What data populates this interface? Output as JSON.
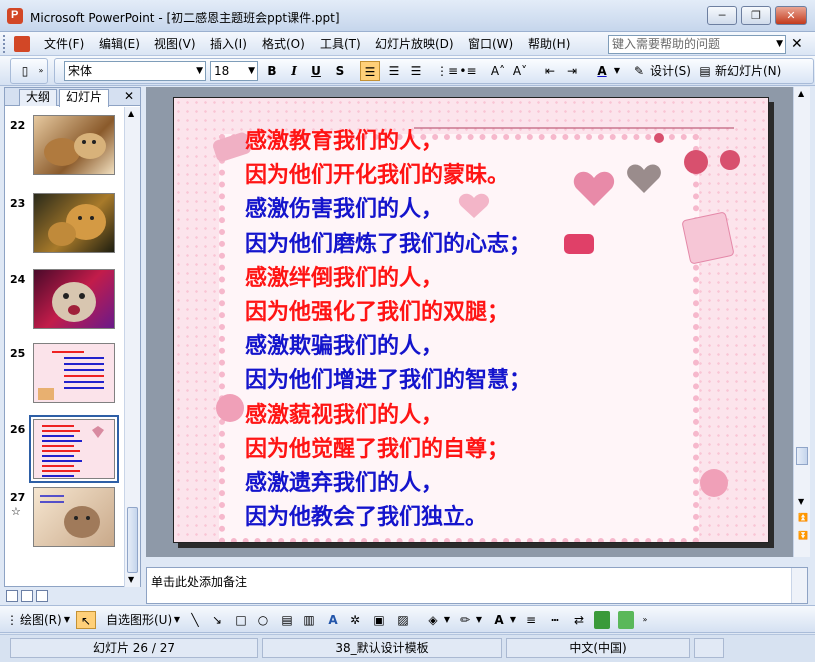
{
  "window": {
    "title": "Microsoft PowerPoint - [初二感恩主题班会ppt课件.ppt]",
    "minimize": "─",
    "restore": "❐",
    "close": "✕"
  },
  "menu": {
    "items": [
      "文件(F)",
      "编辑(E)",
      "视图(V)",
      "插入(I)",
      "格式(O)",
      "工具(T)",
      "幻灯片放映(D)",
      "窗口(W)",
      "帮助(H)"
    ],
    "help_placeholder": "键入需要帮助的问题",
    "close": "✕"
  },
  "toolbar": {
    "font_name": "宋体",
    "font_size": "18",
    "bold": "B",
    "italic": "I",
    "underline": "U",
    "shadow": "S",
    "font_color": "A",
    "design_label": "设计(S)",
    "new_slide_label": "新幻灯片(N)"
  },
  "left_panel": {
    "tab_outline": "大纲",
    "tab_slides": "幻灯片",
    "close": "✕",
    "slides": [
      {
        "num": "22",
        "icon": "cat-photo"
      },
      {
        "num": "23",
        "icon": "cat-photo"
      },
      {
        "num": "24",
        "icon": "cat-photo"
      },
      {
        "num": "25",
        "icon": "text-slide"
      },
      {
        "num": "26",
        "icon": "text-slide",
        "selected": true
      },
      {
        "num": "27",
        "icon": "cat-photo"
      }
    ]
  },
  "slide": {
    "lines": [
      {
        "text": "感激教育我们的人，",
        "color": "red"
      },
      {
        "text": "因为他们开化我们的蒙昧。",
        "color": "red"
      },
      {
        "text": "感激伤害我们的人，",
        "color": "blue"
      },
      {
        "text": "因为他们磨炼了我们的心志；",
        "color": "blue"
      },
      {
        "text": "感激绊倒我们的人，",
        "color": "red"
      },
      {
        "text": "因为他强化了我们的双腿；",
        "color": "red"
      },
      {
        "text": "感激欺骗我们的人，",
        "color": "blue"
      },
      {
        "text": "因为他们增进了我们的智慧；",
        "color": "blue"
      },
      {
        "text": "感激藐视我们的人，",
        "color": "red"
      },
      {
        "text": "因为他觉醒了我们的自尊；",
        "color": "red"
      },
      {
        "text": "感激遗弃我们的人，",
        "color": "blue"
      },
      {
        "text": "因为他教会了我们独立。",
        "color": "blue"
      }
    ]
  },
  "notes": {
    "placeholder": "单击此处添加备注"
  },
  "drawing": {
    "draw_label": "绘图(R)",
    "autoshapes_label": "自选图形(U)"
  },
  "status": {
    "slide_position": "幻灯片 26 / 27",
    "template": "38_默认设计模板",
    "language": "中文(中国)"
  },
  "colors": {
    "red_text": "#ff1414",
    "blue_text": "#1414cc",
    "slide_bg": "#fce4ec"
  }
}
